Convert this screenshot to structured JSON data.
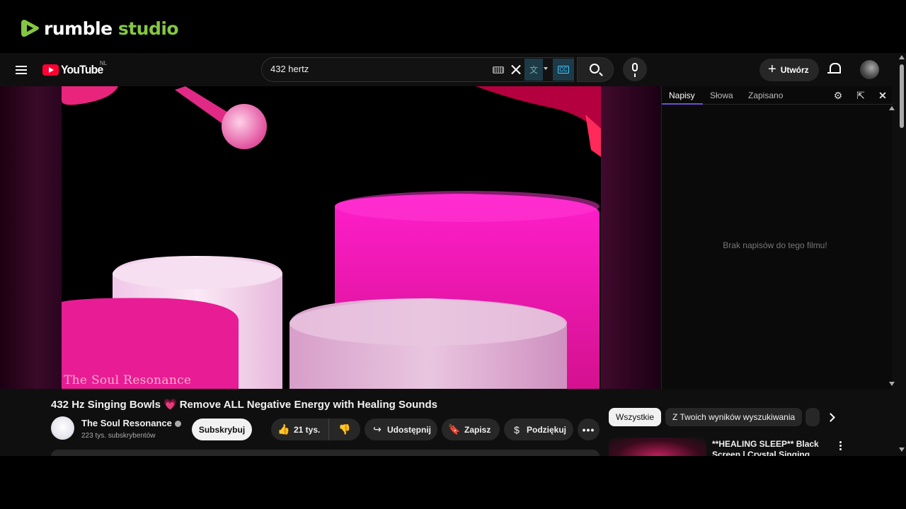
{
  "overlay": {
    "brand_a": "rumble",
    "brand_b": "studio"
  },
  "youtube": {
    "logo_text": "YouTube",
    "country_code": "NL",
    "search": {
      "value": "432 hertz"
    },
    "create_label": "Utwórz"
  },
  "player": {
    "watermark": "The Soul Resonance"
  },
  "transcript_panel": {
    "tabs": [
      "Napisy",
      "Słowa",
      "Zapisano"
    ],
    "empty_message": "Brak napisów do tego filmu!"
  },
  "video": {
    "title": "432 Hz Singing Bowls",
    "title_rest": "Remove ALL Negative Energy with Healing Sounds",
    "channel_name": "The Soul Resonance",
    "subscribers": "223 tys. subskrybentów",
    "subscribe_label": "Subskrybuj",
    "likes": "21 tys.",
    "share_label": "Udostępnij",
    "save_label": "Zapisz",
    "thanks_label": "Podziękuj"
  },
  "chips": {
    "all": "Wszystkie",
    "from_search": "Z Twoich wyników wyszukiwania"
  },
  "related": [
    {
      "title": "**HEALING SLEEP** Black Screen | Crystal Singing Bowls"
    }
  ],
  "colors": {
    "accent_red": "#ff0033",
    "rumble_green": "#85c742",
    "tab_accent": "#6f4cd9"
  }
}
